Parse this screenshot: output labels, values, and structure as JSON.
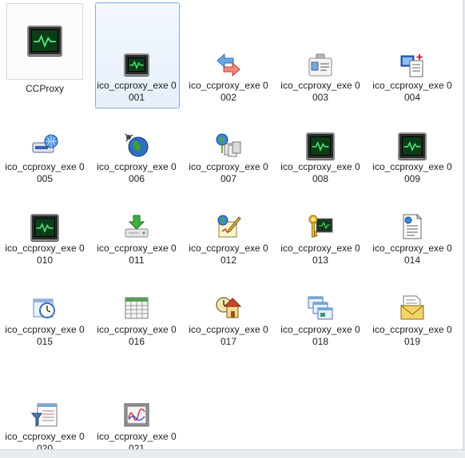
{
  "items": [
    {
      "label": "CCProxy",
      "icon": "ccproxy-monitor-icon"
    },
    {
      "label": "ico_ccproxy_exe 0001",
      "icon": "monitor-icon"
    },
    {
      "label": "ico_ccproxy_exe 0002",
      "icon": "arrows-exchange-icon"
    },
    {
      "label": "ico_ccproxy_exe 0003",
      "icon": "id-card-icon"
    },
    {
      "label": "ico_ccproxy_exe 0004",
      "icon": "computer-document-icon"
    },
    {
      "label": "ico_ccproxy_exe 0005",
      "icon": "network-device-icon"
    },
    {
      "label": "ico_ccproxy_exe 0006",
      "icon": "globe-network-icon"
    },
    {
      "label": "ico_ccproxy_exe 0007",
      "icon": "globe-servers-icon"
    },
    {
      "label": "ico_ccproxy_exe 0008",
      "icon": "monitor-icon"
    },
    {
      "label": "ico_ccproxy_exe 0009",
      "icon": "monitor-icon"
    },
    {
      "label": "ico_ccproxy_exe 0010",
      "icon": "monitor-icon"
    },
    {
      "label": "ico_ccproxy_exe 0011",
      "icon": "download-drive-icon"
    },
    {
      "label": "ico_ccproxy_exe 0012",
      "icon": "globe-pencil-icon"
    },
    {
      "label": "ico_ccproxy_exe 0013",
      "icon": "key-monitor-icon"
    },
    {
      "label": "ico_ccproxy_exe 0014",
      "icon": "web-document-icon"
    },
    {
      "label": "ico_ccproxy_exe 0015",
      "icon": "clock-window-icon"
    },
    {
      "label": "ico_ccproxy_exe 0016",
      "icon": "calendar-table-icon"
    },
    {
      "label": "ico_ccproxy_exe 0017",
      "icon": "clock-house-icon"
    },
    {
      "label": "ico_ccproxy_exe 0018",
      "icon": "stacked-windows-icon"
    },
    {
      "label": "ico_ccproxy_exe 0019",
      "icon": "mail-envelope-icon"
    },
    {
      "label": "ico_ccproxy_exe 0020",
      "icon": "filter-list-icon"
    },
    {
      "label": "ico_ccproxy_exe 0021",
      "icon": "chart-window-icon"
    }
  ]
}
